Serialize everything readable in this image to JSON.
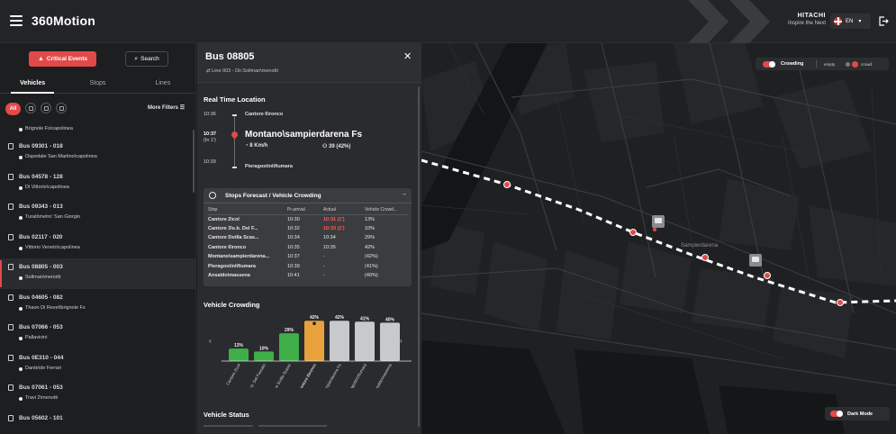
{
  "header": {
    "app_title": "360Motion",
    "brand_name": "HITACHI",
    "brand_tagline": "Inspire the Next",
    "language": "EN"
  },
  "left_panel": {
    "critical_events_label": "Critical Events",
    "search_label": "Search",
    "tabs": [
      {
        "label": "Vehicles",
        "active": true
      },
      {
        "label": "Stops",
        "active": false
      },
      {
        "label": "Lines",
        "active": false
      }
    ],
    "filter_all_label": "All",
    "more_filters_label": "More Filters",
    "first_stop": "Brignole Fs\\capolinea",
    "vehicles": [
      {
        "title": "Bus 09301 - 018",
        "stop": "Ospedale San Martino\\capolinea",
        "selected": false
      },
      {
        "title": "Bus 04578 - 128",
        "stop": "Di Vittorio\\capolinea",
        "selected": false
      },
      {
        "title": "Bus 09343 - 013",
        "stop": "Turati\\metro' San Giorgio",
        "selected": false
      },
      {
        "title": "Bus 02117 - 020",
        "stop": "Vittorio Veneto\\capolinea",
        "selected": false
      },
      {
        "title": "Bus 08805 - 003",
        "stop": "Sollman\\menotti",
        "selected": true
      },
      {
        "title": "Bus 04605 - 082",
        "stop": "Thaon Di Revel\\brignole Fs",
        "selected": false
      },
      {
        "title": "Bus 07066 - 053",
        "stop": "Pallavicini",
        "selected": false
      },
      {
        "title": "Bus 0E310 - 044",
        "stop": "Dante\\de Ferrari",
        "selected": false
      },
      {
        "title": "Bus 07061 - 053",
        "stop": "Travi 2\\menotti",
        "selected": false
      },
      {
        "title": "Bus 05602 - 101",
        "stop": "",
        "selected": false
      }
    ]
  },
  "detail": {
    "title": "Bus 08805",
    "subtitle": "Line 003 - Dir.Sollman\\menotti",
    "real_time_title": "Real Time Location",
    "timeline": [
      {
        "time": "10:36",
        "stop": "Cantore 6\\ronco"
      },
      {
        "time": "10:37",
        "time_note": "(In 1')",
        "stop": "Montano\\sampierdarena Fs",
        "speed": "8 Km/h",
        "crowd": "39 (42%)"
      },
      {
        "time": "10:39",
        "stop": "Pieragostini\\fiumara"
      }
    ],
    "forecast": {
      "title": "Stops Forecast / Vehicle Crowding",
      "headers": [
        "Stop",
        "Pr.arrival",
        "Actual",
        "Vehicle Crowd..."
      ],
      "rows": [
        {
          "stop": "Cantore 2\\col",
          "pr": "10:30",
          "actual": "10:31 (1')",
          "late": true,
          "crowd": "13%"
        },
        {
          "stop": "Cantore 3\\s.b. Del F...",
          "pr": "10:32",
          "actual": "10:33 (1')",
          "late": true,
          "crowd": "10%"
        },
        {
          "stop": "Cantore 5\\villa Scas...",
          "pr": "10:34",
          "actual": "10:34",
          "late": false,
          "crowd": "29%"
        },
        {
          "stop": "Cantore 6\\ronco",
          "pr": "10:35",
          "actual": "10:35",
          "late": false,
          "crowd": "42%"
        },
        {
          "stop": "Montano\\sampierdarena...",
          "pr": "10:37",
          "actual": "-",
          "late": false,
          "crowd": "(42%)"
        },
        {
          "stop": "Pieragostini\\fiumara",
          "pr": "10:39",
          "actual": "-",
          "late": false,
          "crowd": "(41%)"
        },
        {
          "stop": "Ansaldo\\massena",
          "pr": "10:41",
          "actual": "-",
          "late": false,
          "crowd": "(40%)"
        }
      ]
    },
    "crowding_title": "Vehicle Crowding",
    "vehicle_status_title": "Vehicle Status"
  },
  "chart_data": {
    "type": "bar",
    "title": "Vehicle Crowding",
    "categories": [
      "Cantore 2\\col",
      "Cantore 3\\s.b. Del Fossato",
      "Cantore 5\\villa Scassi",
      "Cantore 6\\ronco",
      "Montano\\sampierdarena Fs",
      "Pieragostini\\fiumara",
      "Ansaldo\\massena"
    ],
    "values": [
      13,
      10,
      29,
      42,
      42,
      41,
      40
    ],
    "labels": [
      "13%",
      "10%",
      "29%",
      "42%",
      "42%",
      "41%",
      "40%"
    ],
    "ylim": [
      0,
      45
    ],
    "colors": [
      "#3fae49",
      "#3fae49",
      "#3fae49",
      "#e9a23b",
      "#c8c9cc",
      "#c8c9cc",
      "#c8c9cc"
    ],
    "current_index": 3
  },
  "map": {
    "crowding_label": "Crowding",
    "empty_label": "empty",
    "crowd_label": "crowd",
    "place_label": "Sampierdarena",
    "dark_mode_label": "Dark Mode"
  }
}
